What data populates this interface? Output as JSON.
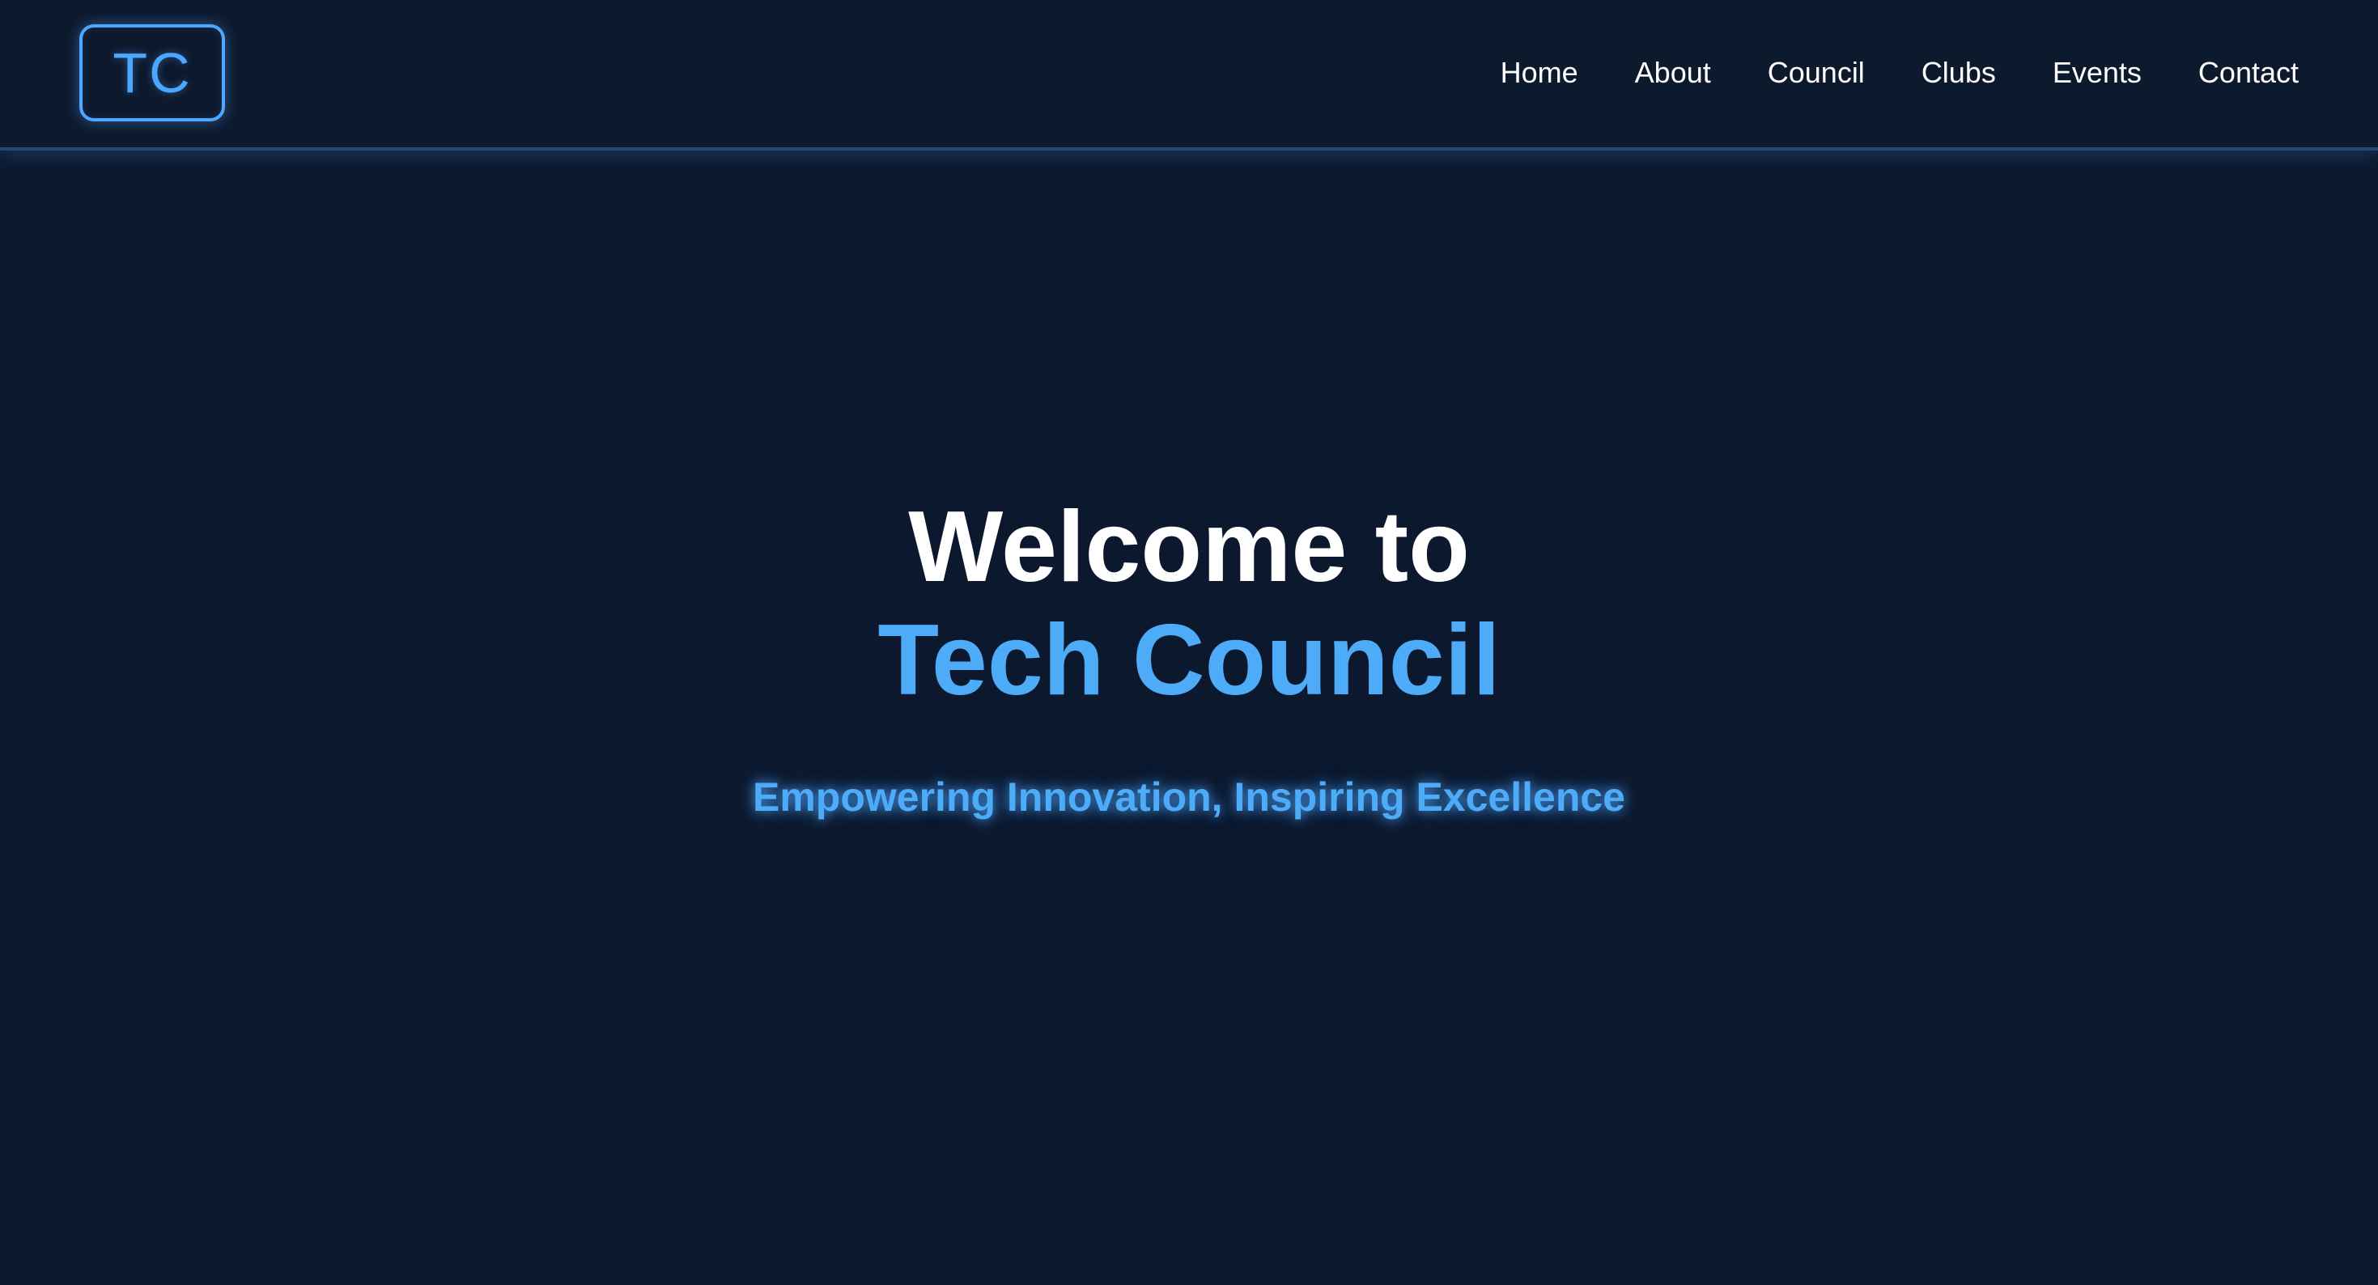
{
  "header": {
    "logo_text": "TC",
    "nav": {
      "items": [
        {
          "label": "Home"
        },
        {
          "label": "About"
        },
        {
          "label": "Council"
        },
        {
          "label": "Clubs"
        },
        {
          "label": "Events"
        },
        {
          "label": "Contact"
        }
      ]
    }
  },
  "hero": {
    "title_line1": "Welcome to",
    "title_line2": "Tech Council",
    "tagline": "Empowering Innovation, Inspiring Excellence"
  },
  "colors": {
    "background": "#0c182d",
    "accent": "#4dabf7",
    "text": "#ffffff"
  }
}
